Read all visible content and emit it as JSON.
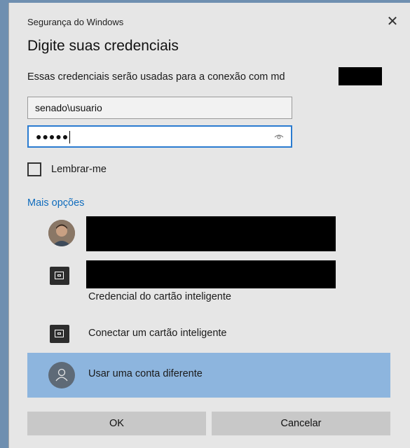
{
  "window": {
    "title": "Segurança do Windows",
    "close_glyph": "✕"
  },
  "heading": "Digite suas credenciais",
  "subtitle": "Essas credenciais serão usadas para a conexão com md",
  "username": {
    "value": "senado\\usuario"
  },
  "password": {
    "masked_value": "●●●●●"
  },
  "remember": {
    "label": "Lembrar-me",
    "checked": false
  },
  "more_options": "Mais opções",
  "accounts": [
    {
      "type": "user",
      "label": ""
    },
    {
      "type": "smartcard",
      "label": "Credencial do cartão inteligente"
    },
    {
      "type": "smartcard",
      "label": "Conectar um cartão inteligente"
    },
    {
      "type": "other",
      "label": "Usar uma conta diferente",
      "selected": true
    }
  ],
  "buttons": {
    "ok": "OK",
    "cancel": "Cancelar"
  },
  "colors": {
    "accent": "#0f6cbd",
    "selected_bg": "#8db5de",
    "input_focus": "#2a7bd0"
  }
}
